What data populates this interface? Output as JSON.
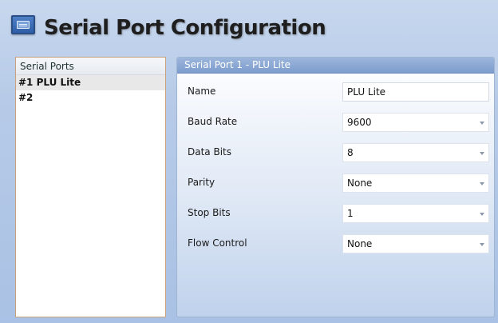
{
  "window": {
    "title": "Serial Port Configuration",
    "icon": "serial-port-icon"
  },
  "ports": {
    "header": "Serial Ports",
    "items": [
      {
        "label": "#1 PLU Lite",
        "selected": true
      },
      {
        "label": "#2",
        "selected": false
      }
    ]
  },
  "settings": {
    "header": "Serial Port 1 - PLU Lite",
    "fields": {
      "name": {
        "label": "Name",
        "value": "PLU Lite"
      },
      "baud_rate": {
        "label": "Baud Rate",
        "value": "9600"
      },
      "data_bits": {
        "label": "Data Bits",
        "value": "8"
      },
      "parity": {
        "label": "Parity",
        "value": "None"
      },
      "stop_bits": {
        "label": "Stop Bits",
        "value": "1"
      },
      "flow_control": {
        "label": "Flow Control",
        "value": "None"
      }
    }
  },
  "colors": {
    "background": "#b7cbe8",
    "header_blue": "#7d9ccd",
    "list_border": "#c8a27d",
    "selection": "#e8e8e8"
  }
}
